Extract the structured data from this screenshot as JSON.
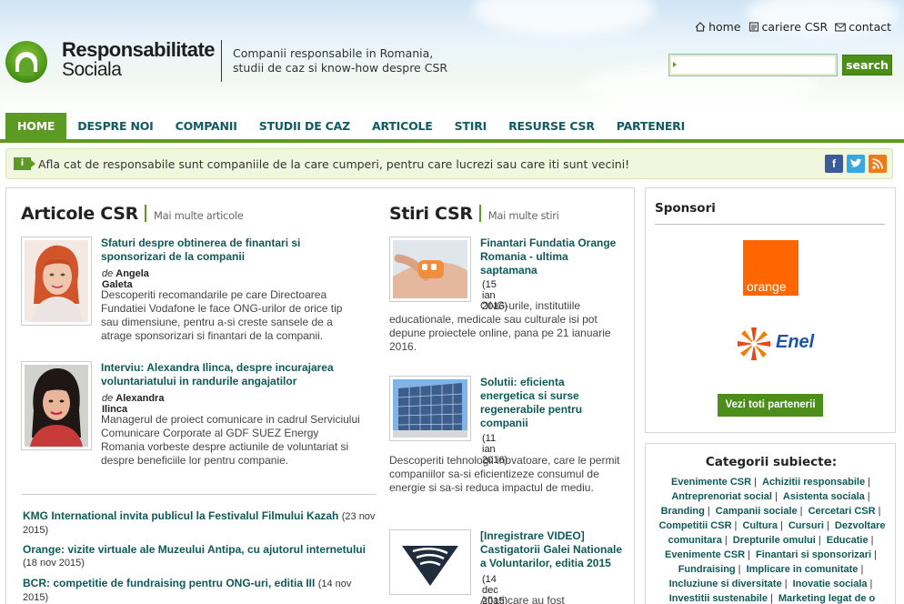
{
  "header": {
    "site_name_line1": "Responsabilitate",
    "site_name_line2": "Sociala",
    "tagline_line1": "Companii responsabile in Romania,",
    "tagline_line2": "studii de caz si know-how despre CSR",
    "toplinks": {
      "home": "home",
      "cariere": "cariere CSR",
      "contact": "contact"
    },
    "search": {
      "value": "",
      "button": "search"
    }
  },
  "nav": {
    "items": [
      {
        "label": "HOME",
        "active": true
      },
      {
        "label": "DESPRE NOI"
      },
      {
        "label": "COMPANII"
      },
      {
        "label": "STUDII DE CAZ"
      },
      {
        "label": "ARTICOLE"
      },
      {
        "label": "STIRI"
      },
      {
        "label": "RESURSE CSR"
      },
      {
        "label": "PARTENERI"
      }
    ]
  },
  "infobar": {
    "icon": "i",
    "text": "Afla cat de responsabile sunt companiile de la care cumperi, pentru care lucrezi sau care iti sunt vecini!",
    "social": {
      "facebook": "f",
      "twitter": "t",
      "rss": "rss"
    }
  },
  "articole": {
    "title": "Articole CSR",
    "more": "Mai multe articole",
    "items": [
      {
        "title": "Sfaturi despre obtinerea de finantari si sponsorizari de la companii",
        "by": "de",
        "author": "Angela Galeta",
        "desc": "Descoperiti recomandarile pe care Directoarea Fundatiei Vodafone le face ONG-urilor de orice tip sau dimensiune, pentru a-si creste sansele de a atrage sponsorizari si finantari de la companii."
      },
      {
        "title": "Interviu: Alexandra Ilinca, despre incurajarea voluntariatului in randurile angajatilor",
        "by": "de",
        "author": "Alexandra Ilinca",
        "desc": "Managerul de proiect comunicare in cadrul Serviciului Comunicare Corporate al GDF SUEZ Energy Romania vorbeste despre actiunile de voluntariat si despre beneficiile lor pentru companie."
      }
    ],
    "links": [
      {
        "title": "KMG International invita publicul la Festivalul Filmului Kazah",
        "date": "(23 nov 2015)"
      },
      {
        "title": "Orange: vizite virtuale ale Muzeului Antipa, cu ajutorul internetului",
        "date": "(18 nov 2015)"
      },
      {
        "title": "BCR: competitie de fundraising pentru ONG-uri, editia III",
        "date": "(14 nov 2015)"
      }
    ]
  },
  "stiri": {
    "title": "Stiri CSR",
    "more": "Mai multe stiri",
    "items": [
      {
        "title": "Finantari Fundatia Orange Romania - ultima saptamana",
        "date": "(15 ian 2016)",
        "desc": "ONG-urile, institutiile educationale, medicale sau culturale isi pot depune proiectele online, pana pe 21 ianuarie 2016."
      },
      {
        "title": "Solutii: eficienta energetica si surse regenerabile pentru companii",
        "date": "(11 ian 2016)",
        "desc": "Descoperiti tehnologii inovatoare, care le permit companiilor sa-si eficientizeze consumul de energie si sa-si reduca impactul de mediu."
      },
      {
        "title": "[Inregistrare VIDEO] Castigatorii Galei Nationale a Voluntarilor, editia 2015",
        "date": "(14 dec 2015)",
        "desc": "Aflati care au fost"
      }
    ]
  },
  "sponsori": {
    "title": "Sponsori",
    "orange": "orange",
    "enel": "Enel",
    "button": "Vezi toti partenerii"
  },
  "categorii": {
    "title": "Categorii subiecte:",
    "items": [
      "Evenimente CSR",
      "Achizitii responsabile",
      "Antreprenoriat social",
      "Asistenta sociala",
      "Branding",
      "Campanii sociale",
      "Cercetari CSR",
      "Competitii CSR",
      "Cultura",
      "Cursuri",
      "Dezvoltare comunitara",
      "Drepturile omului",
      "Educatie",
      "Evenimente CSR",
      "Finantari si sponsorizari",
      "Fundraising",
      "Implicare in comunitate",
      "Incluziune si diversitate",
      "Inovatie sociala",
      "Investitii sustenabile",
      "Marketing legat de o"
    ]
  },
  "colors": {
    "brand_green": "#5c9a23",
    "link_teal": "#0e5a58",
    "nav_teal": "#0f5b66"
  }
}
